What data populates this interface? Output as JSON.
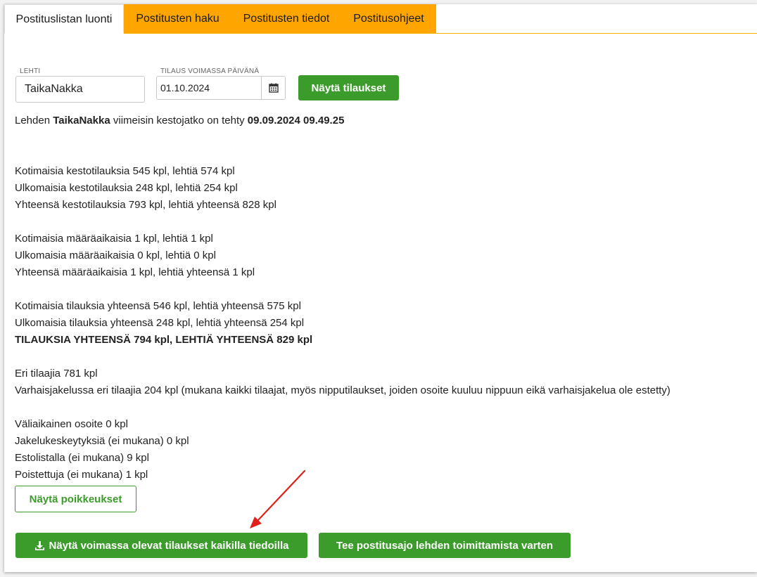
{
  "tabs": [
    {
      "label": "Postituslistan luonti",
      "active": true
    },
    {
      "label": "Postitusten haku",
      "active": false
    },
    {
      "label": "Postitusten tiedot",
      "active": false
    },
    {
      "label": "Postitusohjeet",
      "active": false
    }
  ],
  "form": {
    "lehti_label": "LEHTI",
    "lehti_value": "TaikaNakka",
    "date_label": "TILAUS VOIMASSA PÄIVÄNÄ",
    "date_value": "01.10.2024",
    "show_button": "Näytä tilaukset"
  },
  "info": {
    "prefix": "Lehden ",
    "paper_name": "TaikaNakka",
    "middle": " viimeisin kestojatko on tehty ",
    "timestamp": "09.09.2024 09.49.25"
  },
  "stats": {
    "group1": [
      "Kotimaisia kestotilauksia 545 kpl, lehtiä 574 kpl",
      "Ulkomaisia kestotilauksia 248 kpl, lehtiä 254 kpl",
      "Yhteensä kestotilauksia 793 kpl, lehtiä yhteensä 828 kpl"
    ],
    "group2": [
      "Kotimaisia määräaikaisia 1 kpl, lehtiä 1 kpl",
      "Ulkomaisia määräaikaisia 0 kpl, lehtiä 0 kpl",
      "Yhteensä määräaikaisia 1 kpl, lehtiä yhteensä 1 kpl"
    ],
    "group3": [
      "Kotimaisia tilauksia yhteensä 546 kpl, lehtiä yhteensä 575 kpl",
      "Ulkomaisia tilauksia yhteensä 248 kpl, lehtiä yhteensä 254 kpl",
      "TILAUKSIA YHTEENSÄ 794 kpl, LEHTIÄ YHTEENSÄ 829 kpl"
    ],
    "group4": [
      "Eri tilaajia 781 kpl",
      "Varhaisjakelussa eri tilaajia 204 kpl (mukana kaikki tilaajat, myös nipputilaukset, joiden osoite kuuluu nippuun eikä varhaisjakelua ole estetty)"
    ],
    "group5": [
      "Väliaikainen osoite 0 kpl",
      "Jakelukeskeytyksiä (ei mukana) 0 kpl",
      "Estolistalla (ei mukana) 9 kpl",
      "Poistettuja (ei mukana) 1 kpl"
    ]
  },
  "buttons": {
    "exceptions": "Näytä poikkeukset",
    "download": "Näytä voimassa olevat tilaukset kaikilla tiedoilla",
    "mailing": "Tee postitusajo lehden toimittamista varten"
  },
  "colors": {
    "tab_orange": "#ffa500",
    "button_green": "#3c9c2b",
    "arrow_red": "#e0201b"
  },
  "icons": {
    "calendar": "calendar-icon",
    "download": "download-icon"
  }
}
